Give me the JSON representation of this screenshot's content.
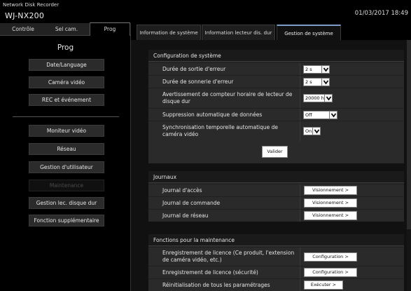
{
  "header": {
    "brand_line1": "Network Disk Recorder",
    "brand_line2": "WJ-NX200",
    "datetime": "01/03/2017 18:49"
  },
  "left_tabs": [
    "Contrôle",
    "Sel cam.",
    "Prog"
  ],
  "left_tab_active": "Prog",
  "section_title": "Prog",
  "menu": {
    "group1": [
      "Date/Language",
      "Caméra vidéo",
      "REC et événement"
    ],
    "group2": [
      "Moniteur vidéo",
      "Réseau",
      "Gestion d'utilisateur",
      "Maintenance",
      "Gestion lec. disque dur",
      "Fonction supplémentaire"
    ]
  },
  "right_tabs": [
    "Information de système",
    "Information lecteur dis. dur",
    "Gestion de système"
  ],
  "right_tab_active": "Gestion de système",
  "config": {
    "title": "Configuration de système",
    "rows": [
      {
        "label": "Durée de sortie d'erreur",
        "value": "2 s"
      },
      {
        "label": "Durée de sonnerie d'erreur",
        "value": "2 s"
      },
      {
        "label": "Avertissement de compteur horaire de lecteur de disque dur",
        "value": "20000 h"
      },
      {
        "label": "Suppression automatique de données",
        "value": "Off"
      },
      {
        "label": "Synchronisation temporelle automatique de caméra vidéo",
        "value": "On"
      }
    ],
    "submit": "Valider"
  },
  "logs": {
    "title": "Journaux",
    "rows": [
      {
        "label": "Journal d'accès",
        "action": "Visionnement >"
      },
      {
        "label": "Journal de commande",
        "action": "Visionnement >"
      },
      {
        "label": "Journal de réseau",
        "action": "Visionnement >"
      }
    ]
  },
  "maintenance": {
    "title": "Fonctions pour la maintenance",
    "rows": [
      {
        "label": "Enregistrement de licence (Ce produit, l'extension de caméra vidéo, etc.)",
        "action": "Configuration >"
      },
      {
        "label": "Enregistrement de licence (sécurité)",
        "action": "Configuration >"
      },
      {
        "label": "Réinitialisation de tous les paramétrages",
        "action": "Exécuter >"
      }
    ]
  },
  "colors": {
    "background": "#000000",
    "panel": "#2a2a2a",
    "active_tab_accent": "#7a9ec8",
    "disabled_text": "#4a4a4a"
  }
}
